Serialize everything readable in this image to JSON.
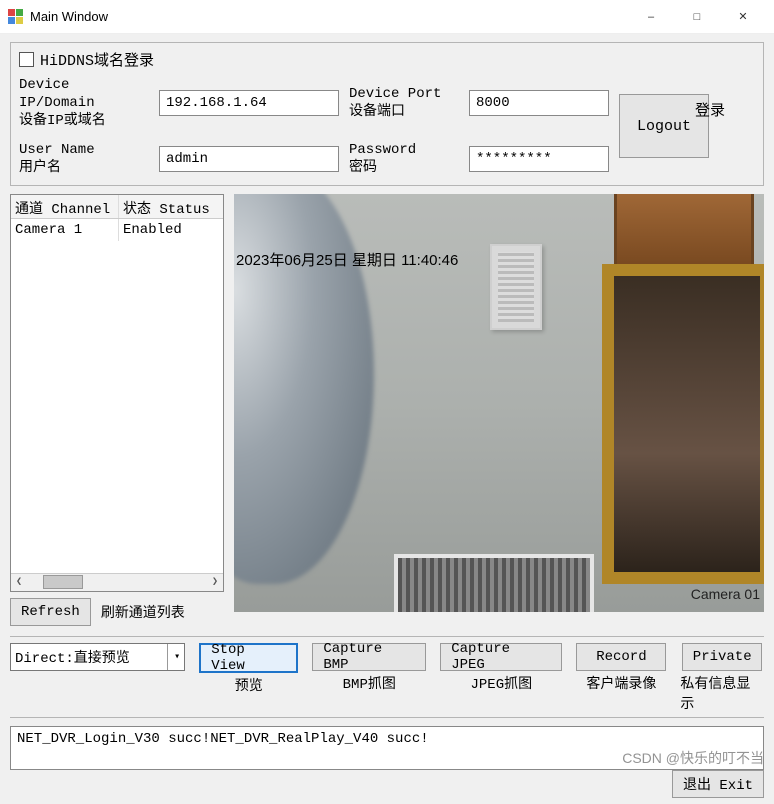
{
  "window": {
    "title": "Main Window"
  },
  "login": {
    "hiddns_label": "HiDDNS域名登录",
    "hiddns_checked": false,
    "ip_label_en": "Device IP/Domain",
    "ip_label_cn": "设备IP或域名",
    "ip_value": "192.168.1.64",
    "port_label_en": "Device Port",
    "port_label_cn": "设备端口",
    "port_value": "8000",
    "user_label_en": "User Name",
    "user_label_cn": "用户名",
    "user_value": "admin",
    "pass_label_en": "Password",
    "pass_label_cn": "密码",
    "pass_value": "*********",
    "login_label": "登录",
    "logout_label": "Logout"
  },
  "channels": {
    "col_channel": "通道 Channel",
    "col_status": "状态 Status",
    "rows": [
      {
        "name": "Camera 1",
        "status": "Enabled"
      }
    ],
    "refresh_btn": "Refresh",
    "refresh_cn": "刷新通道列表"
  },
  "video": {
    "timestamp": "2023年06月25日 星期日 11:40:46",
    "camera_label": "Camera 01"
  },
  "actions": {
    "mode_value": "Direct:直接预览",
    "stop_view": "Stop View",
    "stop_view_cn": "预览",
    "capture_bmp": "Capture BMP",
    "capture_bmp_cn": "BMP抓图",
    "capture_jpeg": "Capture JPEG",
    "capture_jpeg_cn": "JPEG抓图",
    "record": "Record",
    "record_cn": "客户端录像",
    "private": "Private",
    "private_cn": "私有信息显示"
  },
  "log": "NET_DVR_Login_V30 succ!NET_DVR_RealPlay_V40 succ!",
  "exit_label": "退出 Exit",
  "watermark": "CSDN @快乐的叮不当"
}
